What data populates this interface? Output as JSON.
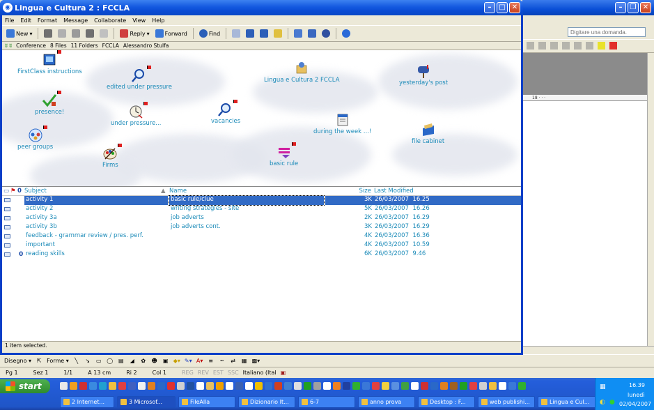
{
  "background_app": {
    "help_placeholder": "Digitare una domanda.",
    "ruler_text": "18 · · ·",
    "drawing_toolbar": {
      "draw_label": "Disegno ▾",
      "autoshapes_label": "Forme ▾"
    },
    "status": {
      "page": "Pg 1",
      "section": "Sez 1",
      "pages": "1/1",
      "at": "A 13 cm",
      "line": "Ri 2",
      "col": "Col 1",
      "rec": "REG",
      "trk": "REV",
      "ext": "EST",
      "ovr": "SSC",
      "language": "Italiano (Ital"
    }
  },
  "fc_window": {
    "title": "Lingua e Cultura 2 : FCCLA",
    "menu": [
      "File",
      "Edit",
      "Format",
      "Message",
      "Collaborate",
      "View",
      "Help"
    ],
    "toolbar": {
      "new_label": "New",
      "reply_label": "Reply",
      "forward_label": "Forward",
      "find_label": "Find"
    },
    "info": {
      "type": "Conference",
      "files": "8 Files",
      "folders": "11 Folders",
      "owner": "FCCLA",
      "user": "Alessandro Stulfa"
    },
    "desktop_items": [
      {
        "label": "FirstClass instructions",
        "icon": "book-icon"
      },
      {
        "label": "edited under pressure",
        "icon": "magnifier-icon"
      },
      {
        "label": "Lingua e Cultura 2  FCCLA",
        "icon": "conference-icon"
      },
      {
        "label": "yesterday's post",
        "icon": "mailbox-icon"
      },
      {
        "label": "presence!",
        "icon": "checkmark-icon"
      },
      {
        "label": "under pressure...",
        "icon": "clock-icon"
      },
      {
        "label": "vacancies",
        "icon": "magnifier-icon"
      },
      {
        "label": "during the week ...!",
        "icon": "calendar-icon"
      },
      {
        "label": "file cabinet",
        "icon": "file-cabinet-icon"
      },
      {
        "label": "peer groups",
        "icon": "people-icon"
      },
      {
        "label": "Firms",
        "icon": "palette-icon"
      },
      {
        "label": "basic rule",
        "icon": "pen-icon"
      }
    ],
    "list": {
      "headers": {
        "subject": "Subject",
        "name": "Name",
        "size": "Size",
        "modified": "Last Modified"
      },
      "rows": [
        {
          "subject": "activity 1",
          "name": "basic rule/clue",
          "size": "3K",
          "date": "26/03/2007",
          "time": "16.25",
          "selected": true
        },
        {
          "subject": "activity 2",
          "name": "writing strategies - site",
          "size": "5K",
          "date": "26/03/2007",
          "time": "16.26"
        },
        {
          "subject": "activity 3a",
          "name": "job adverts",
          "size": "2K",
          "date": "26/03/2007",
          "time": "16.29"
        },
        {
          "subject": "activity 3b",
          "name": "job adverts cont.",
          "size": "3K",
          "date": "26/03/2007",
          "time": "16.29"
        },
        {
          "subject": "feedback - grammar review / pres. perf.",
          "name": "",
          "size": "4K",
          "date": "26/03/2007",
          "time": "16.36"
        },
        {
          "subject": "important",
          "name": "",
          "size": "4K",
          "date": "26/03/2007",
          "time": "10.59"
        },
        {
          "subject": "reading skills",
          "name": "",
          "size": "6K",
          "date": "26/03/2007",
          "time": "9.46",
          "attachment": true
        }
      ]
    },
    "status": "1 item selected."
  },
  "taskbar": {
    "start_label": "start",
    "tasks": [
      "2 Internet...",
      "3 Microsof...",
      "FileAlla",
      "Dizionario It...",
      "6-7",
      "anno prova",
      "Desktop : F...",
      "web publishi...",
      "Lingua e Cul..."
    ],
    "tray": {
      "time": "16.39",
      "day": "lunedì",
      "date": "02/04/2007"
    }
  }
}
